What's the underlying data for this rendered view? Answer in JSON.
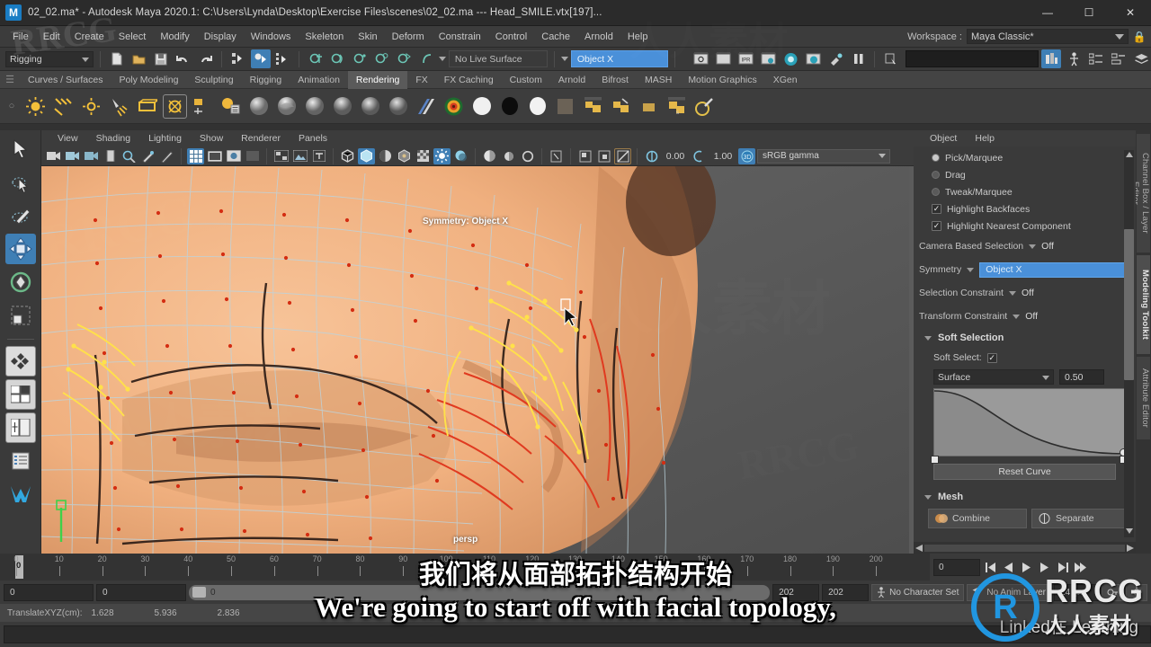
{
  "window": {
    "title": "02_02.ma* - Autodesk Maya 2020.1: C:\\Users\\Lynda\\Desktop\\Exercise Files\\scenes\\02_02.ma  ---  Head_SMILE.vtx[197]...",
    "logo_letter": "M",
    "minimize": "—",
    "maximize": "☐",
    "close": "✕"
  },
  "menubar": {
    "items": [
      "File",
      "Edit",
      "Create",
      "Select",
      "Modify",
      "Display",
      "Windows",
      "Skeleton",
      "Skin",
      "Deform",
      "Constrain",
      "Control",
      "Cache",
      "Arnold",
      "Help"
    ],
    "workspace_label": "Workspace :",
    "workspace_value": "Maya Classic*",
    "lock_icon": "🔒"
  },
  "statusline": {
    "mode": "Rigging",
    "live_surface": "No Live Surface",
    "symmetry_field": "Object X",
    "command_placeholder": ""
  },
  "shelf": {
    "tabs": [
      "Curves / Surfaces",
      "Poly Modeling",
      "Sculpting",
      "Rigging",
      "Animation",
      "Rendering",
      "FX",
      "FX Caching",
      "Custom",
      "Arnold",
      "Bifrost",
      "MASH",
      "Motion Graphics",
      "XGen"
    ],
    "active_tab": "Rendering"
  },
  "viewport": {
    "menus": [
      "View",
      "Shading",
      "Lighting",
      "Show",
      "Renderer",
      "Panels"
    ],
    "exposure_value": "0.00",
    "gamma_value": "1.00",
    "color_space": "sRGB gamma",
    "symmetry_label": "Symmetry: Object X",
    "camera_label": "persp"
  },
  "toolkit": {
    "menus": [
      "Object",
      "Help"
    ],
    "options": [
      {
        "label": "Pick/Marquee",
        "type": "radio",
        "checked": true
      },
      {
        "label": "Drag",
        "type": "radio",
        "checked": false
      },
      {
        "label": "Tweak/Marquee",
        "type": "radio",
        "checked": false
      },
      {
        "label": "Highlight Backfaces",
        "type": "check",
        "checked": true
      },
      {
        "label": "Highlight Nearest Component",
        "type": "check",
        "checked": true
      }
    ],
    "attrs": [
      {
        "label": "Camera Based Selection",
        "value": "Off"
      },
      {
        "label": "Selection Constraint",
        "value": "Off"
      },
      {
        "label": "Transform Constraint",
        "value": "Off"
      }
    ],
    "symmetry_label": "Symmetry",
    "symmetry_value": "Object X",
    "soft_selection_header": "Soft Selection",
    "soft_select_label": "Soft Select:",
    "falloff_mode": "Surface",
    "falloff_radius": "0.50",
    "reset_curve": "Reset Curve",
    "mesh_header": "Mesh",
    "mesh_buttons": [
      "Combine",
      "Separate"
    ],
    "right_tabs": [
      "Channel Box / Layer Editor",
      "Modeling Toolkit",
      "Attribute Editor"
    ],
    "active_right_tab": "Modeling Toolkit"
  },
  "timeline": {
    "ticks": [
      0,
      10,
      20,
      30,
      40,
      50,
      60,
      70,
      80,
      90,
      100,
      110,
      120,
      130,
      140,
      150,
      160,
      170,
      180,
      190,
      200
    ],
    "current_frame": "0",
    "range_start": "0",
    "range_end": "0",
    "range_bar_value": "0",
    "playback_end": "202",
    "anim_end": "202",
    "fps": "24 fps",
    "right_field": "0",
    "playback_buttons": [
      "⏮",
      "◀",
      "▶",
      "⏭",
      "▶|",
      "⏭⏭"
    ]
  },
  "helpline": {
    "label": "TranslateXYZ(cm):",
    "values": [
      "1.628",
      "5.936",
      "2.836"
    ]
  },
  "statusbar": {
    "no_character_set": "No Character Set",
    "no_anim_layer": "No Anim Layer"
  },
  "subtitles": {
    "chinese": "我们将从面部拓扑结构开始",
    "english": "We're going to start off with facial topology,"
  },
  "branding": {
    "rrcg": "RRCG",
    "chinese": "人人素材",
    "linkedin": "Linked在 Learning",
    "logo_letter": "R"
  },
  "colors": {
    "accent_blue": "#4a90d9",
    "selection_blue": "#3f7fb5",
    "panel_bg": "#3a3a3a",
    "titlebar_bg": "#2b2b2b",
    "brand_blue": "#2196e0"
  }
}
